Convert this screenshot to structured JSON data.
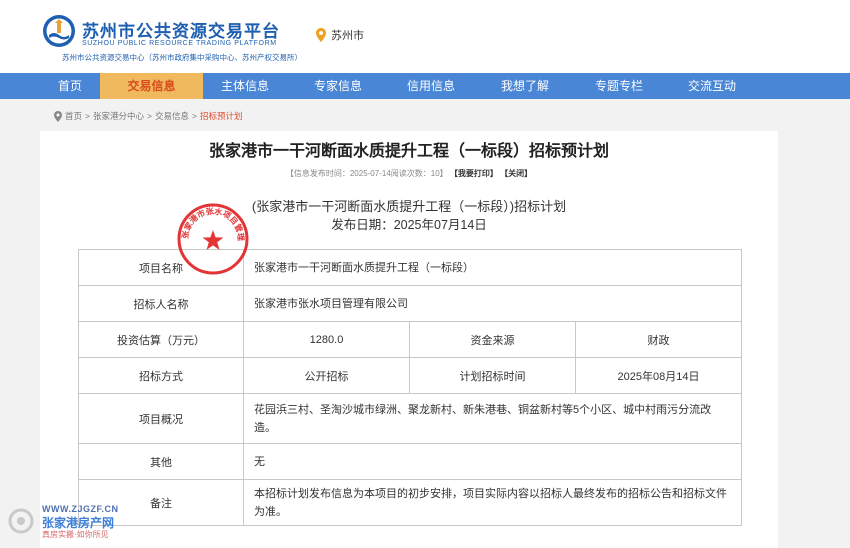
{
  "header": {
    "logo_name": "苏州市公共资源交易平台",
    "logo_english": "SUZHOU PUBLIC RESOURCE TRADING PLATFORM",
    "logo_subtitle": "苏州市公共资源交易中心（苏州市政府集中采购中心、苏州产权交易所）",
    "city": "苏州市",
    "pin_icon": "map-pin-icon",
    "brand_color": "#1e5fb0"
  },
  "nav": {
    "bar_color": "#4a86d6",
    "active_color": "#f0b95e",
    "items": [
      {
        "label": "首页"
      },
      {
        "label": "交易信息"
      },
      {
        "label": "主体信息"
      },
      {
        "label": "专家信息"
      },
      {
        "label": "信用信息"
      },
      {
        "label": "我想了解"
      },
      {
        "label": "专题专栏"
      },
      {
        "label": "交流互动"
      }
    ],
    "active_index": 1
  },
  "breadcrumb": {
    "items": [
      "首页",
      "张家港分中心",
      "交易信息",
      "招标预计划"
    ],
    "separator": ">"
  },
  "article": {
    "title": "张家港市一干河断面水质提升工程（一标段）招标预计划",
    "publish_label": "【信息发布时间：2025-07-14阅读次数：10】",
    "print_label": "【我要打印】",
    "close_label": "【关闭】",
    "plan_title": "(张家港市一干河断面水质提升工程（一标段）)招标计划",
    "plan_date": "发布日期：2025年07月14日"
  },
  "table": {
    "project_name_label": "项目名称",
    "project_name": "张家港市一干河断面水质提升工程（一标段）",
    "tenderer_label": "招标人名称",
    "tenderer": "张家港市张水项目管理有限公司",
    "investment_label": "投资估算（万元）",
    "investment": "1280.0",
    "fund_source_label": "资金来源",
    "fund_source": "财政",
    "method_label": "招标方式",
    "method": "公开招标",
    "planned_time_label": "计划招标时间",
    "planned_time": "2025年08月14日",
    "overview_label": "项目概况",
    "overview": "花园浜三村、圣淘沙城市绿洲、聚龙新村、新朱港巷、铜盆新村等5个小区、城中村雨污分流改造。",
    "other_label": "其他",
    "other": "无",
    "remark_label": "备注",
    "remark": "本招标计划发布信息为本项目的初步安排，项目实际内容以招标人最终发布的招标公告和招标文件为准。"
  },
  "seal": {
    "text": "张家港市张水项目管理有限公司",
    "color": "#e02020"
  },
  "watermark": {
    "url": "WWW.ZJGZF.CN",
    "name": "张家港房产网",
    "slogan": "真房实搬·如你所见"
  }
}
